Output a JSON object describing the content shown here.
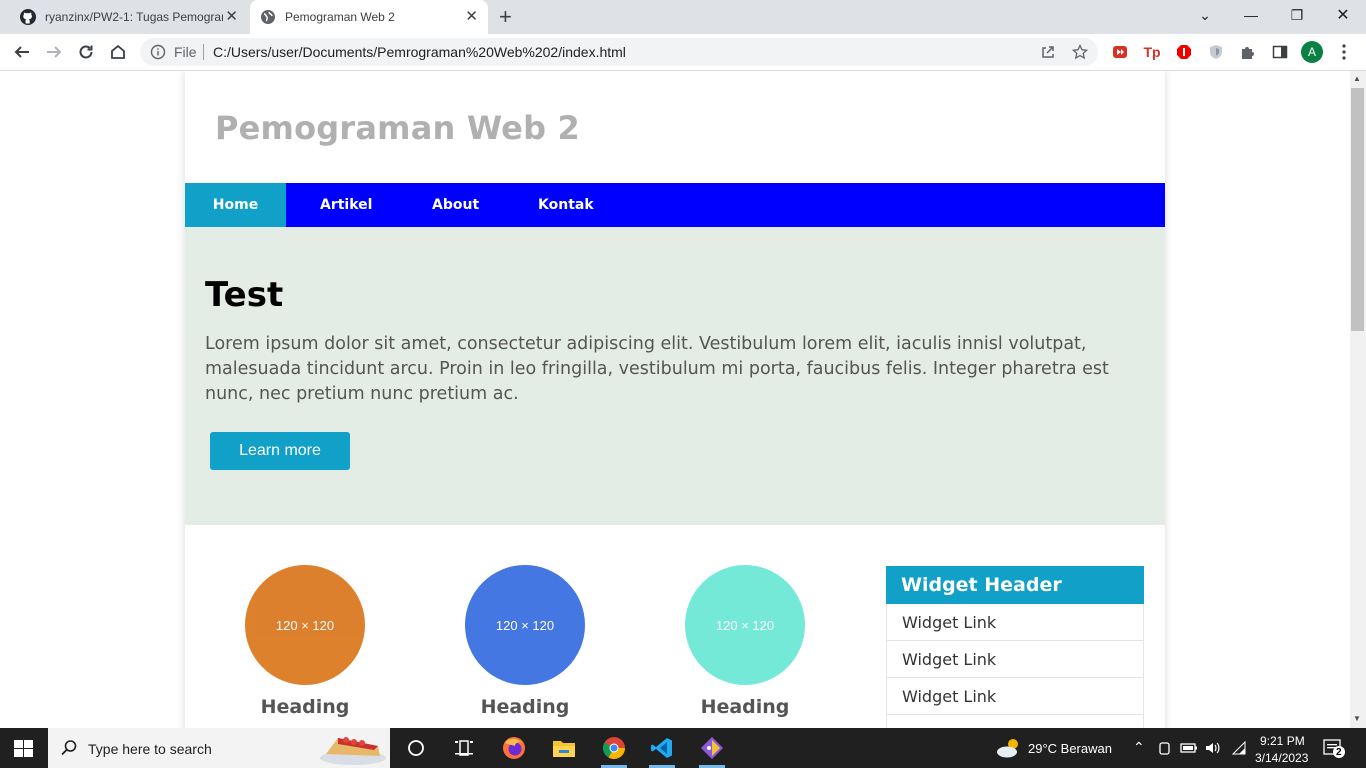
{
  "browser": {
    "tabs": [
      {
        "title": "ryanzinx/PW2-1: Tugas Pemograman Web 2",
        "active": false,
        "favicon": "github-icon"
      },
      {
        "title": "Pemograman Web 2",
        "active": true,
        "favicon": "globe-icon"
      }
    ],
    "address": {
      "scheme_label": "File",
      "url": "C:/Users/user/Documents/Pemrograman%20Web%202/index.html"
    },
    "profile_initial": "A"
  },
  "page": {
    "site_title": "Pemograman Web 2",
    "nav": {
      "items": [
        {
          "label": "Home",
          "active": true
        },
        {
          "label": "Artikel",
          "active": false
        },
        {
          "label": "About",
          "active": false
        },
        {
          "label": "Kontak",
          "active": false
        }
      ]
    },
    "hero": {
      "title": "Test",
      "text": "Lorem ipsum dolor sit amet, consectetur adipiscing elit. Vestibulum lorem elit, iaculis innisl volutpat, malesuada tincidunt arcu. Proin in leo fringilla, vestibulum mi porta, faucibus felis. Integer pharetra est nunc, nec pretium nunc pretium ac.",
      "button_label": "Learn more"
    },
    "features": [
      {
        "placeholder": "120 × 120",
        "heading": "Heading",
        "color": "#dc7a22"
      },
      {
        "placeholder": "120 × 120",
        "heading": "Heading",
        "color": "#3a70e0"
      },
      {
        "placeholder": "120 × 120",
        "heading": "Heading",
        "color": "#6ee8d6"
      }
    ],
    "widget": {
      "header": "Widget Header",
      "links": [
        "Widget Link",
        "Widget Link",
        "Widget Link"
      ]
    }
  },
  "taskbar": {
    "search_placeholder": "Type here to search",
    "weather": "29°C  Berawan",
    "time": "9:21 PM",
    "date": "3/14/2023",
    "notification_count": "2"
  },
  "colors": {
    "nav_bg": "#0000ff",
    "accent": "#11a0c8",
    "hero_bg": "#e4ece6"
  }
}
